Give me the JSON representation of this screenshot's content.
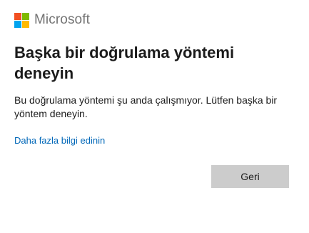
{
  "brand": {
    "logo_icon": "microsoft-logo-icon",
    "name": "Microsoft",
    "logo_colors": [
      "#f25022",
      "#7fba00",
      "#00a4ef",
      "#ffb900"
    ]
  },
  "dialog": {
    "title": "Başka bir doğrulama yöntemi deneyin",
    "description": "Bu doğrulama yöntemi şu anda çalışmıyor. Lütfen başka bir yöntem deneyin.",
    "more_info_link": "Daha fazla bilgi edinin",
    "back_button": "Geri"
  },
  "colors": {
    "link": "#0067b8",
    "button_bg": "#cccccc",
    "text": "#1b1b1b"
  }
}
